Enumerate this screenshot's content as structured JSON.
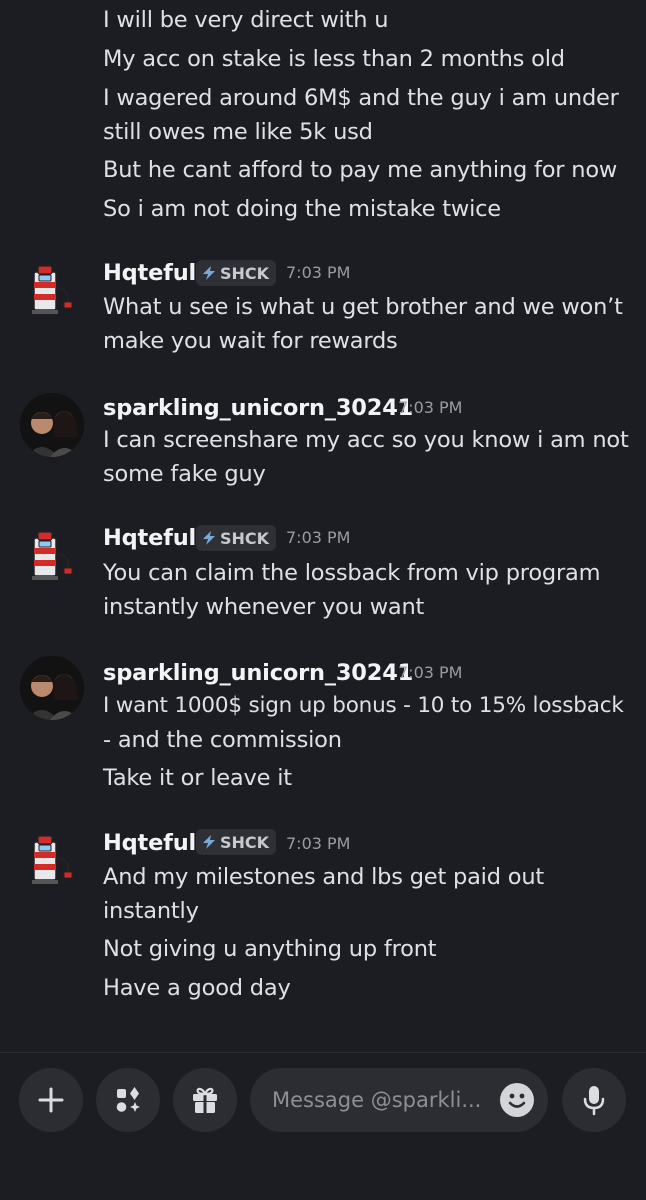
{
  "messages": [
    {
      "author": "",
      "continuation": true,
      "lines": [
        "I will be very direct with u",
        "My acc on stake is less than 2 months old",
        "I wagered around 6M$ and the guy i am under",
        "still owes me like 5k usd",
        "But he cant afford to pay me anything for now",
        "So i am not doing the mistake twice"
      ]
    },
    {
      "author": "Hqteful",
      "tag": "SHCK",
      "time": "7:03 PM",
      "avatar": "robot-gas-pump-avatar",
      "lines": [
        "What u see is what u get brother and we won’t",
        "make you wait for rewards"
      ]
    },
    {
      "author": "sparkling_unicorn_30241",
      "time": "7:03 PM",
      "avatar": "couple-photo-avatar",
      "lines": [
        "I can screenshare my acc so you know i am not",
        "some fake guy"
      ]
    },
    {
      "author": "Hqteful",
      "tag": "SHCK",
      "time": "7:03 PM",
      "avatar": "robot-gas-pump-avatar",
      "lines": [
        "You can claim the lossback from vip program",
        "instantly whenever you want"
      ]
    },
    {
      "author": "sparkling_unicorn_30241",
      "time": "7:03 PM",
      "avatar": "couple-photo-avatar",
      "lines": [
        "I want 1000$ sign up bonus - 10 to 15% lossback",
        "- and the commission",
        "Take it or leave it"
      ]
    },
    {
      "author": "Hqteful",
      "tag": "SHCK",
      "time": "7:03 PM",
      "avatar": "robot-gas-pump-avatar",
      "lines": [
        "And my milestones and lbs get paid out",
        "instantly",
        "Not giving u anything up front",
        "Have a good day"
      ]
    }
  ],
  "composer": {
    "placeholder": "Message @sparkli...",
    "buttons": [
      "plus-icon",
      "apps-icon",
      "gift-icon",
      "microphone-icon"
    ],
    "emoji_icon": "smiley-face-icon"
  },
  "colors": {
    "background": "#1c1d22",
    "input_background": "#2c2d33",
    "text": "#dfe0e4",
    "muted": "#9a9ca3"
  }
}
